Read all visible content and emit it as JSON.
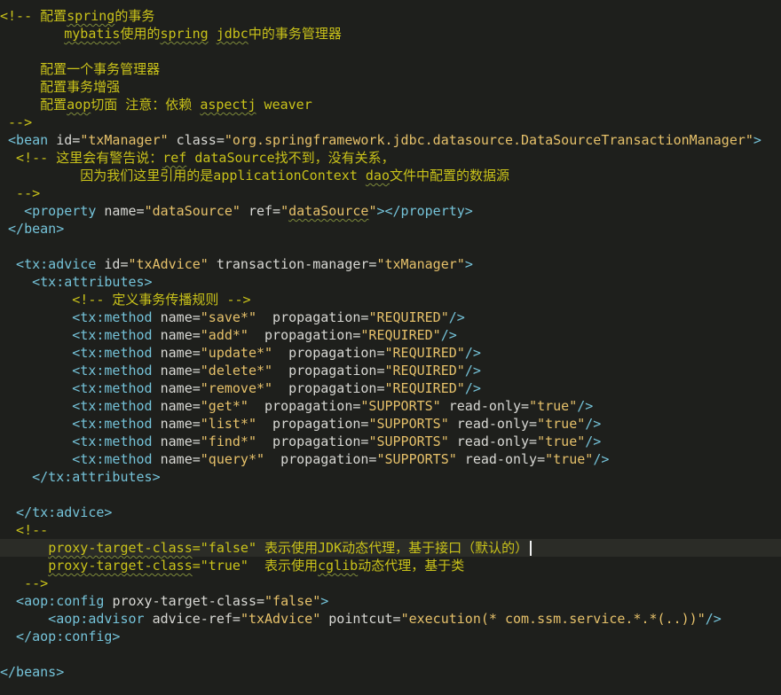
{
  "editor": {
    "colors": {
      "background": "#1e1f1c",
      "current_line": "#2b2c27",
      "comment": "#c9c21a",
      "tag": "#75c3d9",
      "attribute": "#d8d8d4",
      "value": "#e6c16a"
    },
    "lines": [
      [
        [
          "c",
          "<!-- 配置"
        ],
        [
          "c",
          "spring",
          true
        ],
        [
          "c",
          "的事务"
        ]
      ],
      [
        [
          "c",
          "        "
        ],
        [
          "c",
          "mybatis",
          true
        ],
        [
          "c",
          "使用的"
        ],
        [
          "c",
          "spring",
          true
        ],
        [
          "c",
          " "
        ],
        [
          "c",
          "jdbc",
          true
        ],
        [
          "c",
          "中的事务管理器"
        ]
      ],
      [
        [
          "c",
          ""
        ]
      ],
      [
        [
          "c",
          "     配置一个事务管理器"
        ]
      ],
      [
        [
          "c",
          "     配置事务增强"
        ]
      ],
      [
        [
          "c",
          "     配置"
        ],
        [
          "c",
          "aop",
          true
        ],
        [
          "c",
          "切面 注意：依赖 "
        ],
        [
          "c",
          "aspectj",
          true
        ],
        [
          "c",
          " weaver"
        ]
      ],
      [
        [
          "c",
          " -->"
        ]
      ],
      [
        [
          "t",
          " <bean "
        ],
        [
          "a",
          "id="
        ],
        [
          "s",
          "\"txManager\""
        ],
        [
          "a",
          " class="
        ],
        [
          "s",
          "\"org.springframework.jdbc.datasource.DataSourceTransactionManager\""
        ],
        [
          "t",
          ">"
        ]
      ],
      [
        [
          "c",
          "  <!-- 这里会有警告说："
        ],
        [
          "c",
          "ref",
          true
        ],
        [
          "c",
          " dataSource找不到，没有关系，"
        ]
      ],
      [
        [
          "c",
          "          因为我们这里引用的是applicationContext "
        ],
        [
          "c",
          "dao",
          true
        ],
        [
          "c",
          "文件中配置的数据源"
        ]
      ],
      [
        [
          "c",
          "  -->"
        ]
      ],
      [
        [
          "t",
          "   <property "
        ],
        [
          "a",
          "name="
        ],
        [
          "s",
          "\"dataSource\""
        ],
        [
          "a",
          " ref="
        ],
        [
          "s",
          "\"",
          false
        ],
        [
          "s",
          "dataSource",
          true
        ],
        [
          "s",
          "\""
        ],
        [
          "t",
          "></property>"
        ]
      ],
      [
        [
          "t",
          " </bean>"
        ]
      ],
      [
        [
          "p",
          ""
        ]
      ],
      [
        [
          "t",
          "  <tx:advice "
        ],
        [
          "a",
          "id="
        ],
        [
          "s",
          "\"txAdvice\""
        ],
        [
          "a",
          " transaction-manager="
        ],
        [
          "s",
          "\"txManager\""
        ],
        [
          "t",
          ">"
        ]
      ],
      [
        [
          "t",
          "    <tx:attributes>"
        ]
      ],
      [
        [
          "c",
          "         <!-- 定义事务传播规则 -->"
        ]
      ],
      [
        [
          "t",
          "         <tx:method "
        ],
        [
          "a",
          "name="
        ],
        [
          "s",
          "\"save*\""
        ],
        [
          "a",
          "  propagation="
        ],
        [
          "s",
          "\"REQUIRED\""
        ],
        [
          "t",
          "/>"
        ]
      ],
      [
        [
          "t",
          "         <tx:method "
        ],
        [
          "a",
          "name="
        ],
        [
          "s",
          "\"add*\""
        ],
        [
          "a",
          "  propagation="
        ],
        [
          "s",
          "\"REQUIRED\""
        ],
        [
          "t",
          "/>"
        ]
      ],
      [
        [
          "t",
          "         <tx:method "
        ],
        [
          "a",
          "name="
        ],
        [
          "s",
          "\"update*\""
        ],
        [
          "a",
          "  propagation="
        ],
        [
          "s",
          "\"REQUIRED\""
        ],
        [
          "t",
          "/>"
        ]
      ],
      [
        [
          "t",
          "         <tx:method "
        ],
        [
          "a",
          "name="
        ],
        [
          "s",
          "\"delete*\""
        ],
        [
          "a",
          "  propagation="
        ],
        [
          "s",
          "\"REQUIRED\""
        ],
        [
          "t",
          "/>"
        ]
      ],
      [
        [
          "t",
          "         <tx:method "
        ],
        [
          "a",
          "name="
        ],
        [
          "s",
          "\"remove*\""
        ],
        [
          "a",
          "  propagation="
        ],
        [
          "s",
          "\"REQUIRED\""
        ],
        [
          "t",
          "/>"
        ]
      ],
      [
        [
          "t",
          "         <tx:method "
        ],
        [
          "a",
          "name="
        ],
        [
          "s",
          "\"get*\""
        ],
        [
          "a",
          "  propagation="
        ],
        [
          "s",
          "\"SUPPORTS\""
        ],
        [
          "a",
          " read-only="
        ],
        [
          "s",
          "\"true\""
        ],
        [
          "t",
          "/>"
        ]
      ],
      [
        [
          "t",
          "         <tx:method "
        ],
        [
          "a",
          "name="
        ],
        [
          "s",
          "\"list*\""
        ],
        [
          "a",
          "  propagation="
        ],
        [
          "s",
          "\"SUPPORTS\""
        ],
        [
          "a",
          " read-only="
        ],
        [
          "s",
          "\"true\""
        ],
        [
          "t",
          "/>"
        ]
      ],
      [
        [
          "t",
          "         <tx:method "
        ],
        [
          "a",
          "name="
        ],
        [
          "s",
          "\"find*\""
        ],
        [
          "a",
          "  propagation="
        ],
        [
          "s",
          "\"SUPPORTS\""
        ],
        [
          "a",
          " read-only="
        ],
        [
          "s",
          "\"true\""
        ],
        [
          "t",
          "/>"
        ]
      ],
      [
        [
          "t",
          "         <tx:method "
        ],
        [
          "a",
          "name="
        ],
        [
          "s",
          "\"query*\""
        ],
        [
          "a",
          "  propagation="
        ],
        [
          "s",
          "\"SUPPORTS\""
        ],
        [
          "a",
          " read-only="
        ],
        [
          "s",
          "\"true\""
        ],
        [
          "t",
          "/>"
        ]
      ],
      [
        [
          "t",
          "    </tx:attributes>"
        ]
      ],
      [
        [
          "p",
          ""
        ]
      ],
      [
        [
          "t",
          "  </tx:advice>"
        ]
      ],
      [
        [
          "c",
          "  <!--"
        ]
      ],
      [
        [
          "c",
          "      "
        ],
        [
          "c",
          "proxy-target-class",
          true
        ],
        [
          "c",
          "=\"false\" 表示使用JDK动态代理，基于接口（默认的）"
        ]
      ],
      [
        [
          "c",
          "      "
        ],
        [
          "c",
          "proxy-target-class",
          true
        ],
        [
          "c",
          "=\"true\"  表示使用"
        ],
        [
          "c",
          "cglib",
          true
        ],
        [
          "c",
          "动态代理，基于类"
        ]
      ],
      [
        [
          "c",
          "   -->"
        ]
      ],
      [
        [
          "t",
          "  <aop:config "
        ],
        [
          "a",
          "proxy-target-class="
        ],
        [
          "s",
          "\"false\""
        ],
        [
          "t",
          ">"
        ]
      ],
      [
        [
          "t",
          "      <aop:advisor "
        ],
        [
          "a",
          "advice-ref="
        ],
        [
          "s",
          "\"txAdvice\""
        ],
        [
          "a",
          " pointcut="
        ],
        [
          "s",
          "\"execution(* com.ssm.service.*.*(..))\""
        ],
        [
          "t",
          "/>"
        ]
      ],
      [
        [
          "t",
          "  </aop:config>"
        ]
      ],
      [
        [
          "p",
          ""
        ]
      ],
      [
        [
          "t",
          "</beans>"
        ]
      ]
    ],
    "current_line_index": 30
  }
}
